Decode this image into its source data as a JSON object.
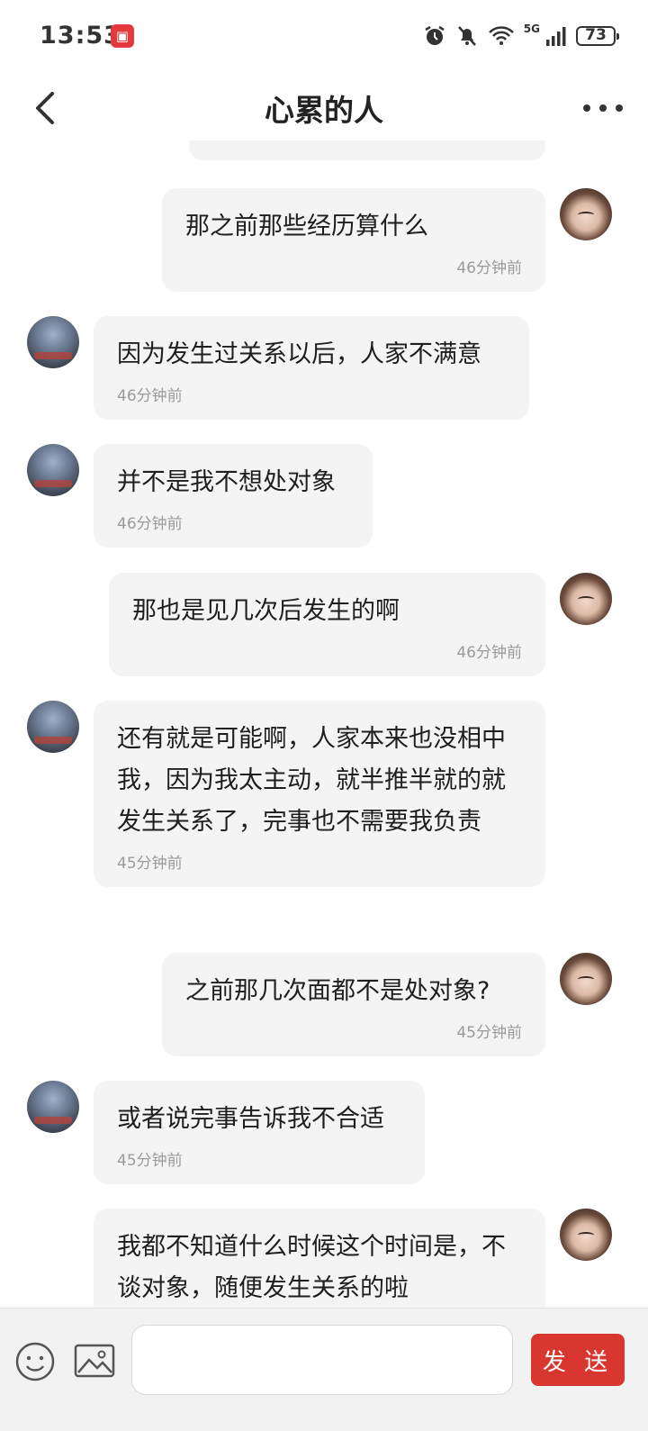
{
  "status_bar": {
    "time": "13:53",
    "app_icon": "calendar-icon",
    "network": "5G",
    "battery": "73"
  },
  "header": {
    "title": "心累的人",
    "back_icon": "back-arrow-icon",
    "more_icon": "more-dots-icon"
  },
  "messages": [
    {
      "sender": "self",
      "text": "那之前那些经历算什么",
      "time": "46分钟前"
    },
    {
      "sender": "other",
      "text": "因为发生过关系以后，人家不满意",
      "time": "46分钟前"
    },
    {
      "sender": "other",
      "text": "并不是我不想处对象",
      "time": "46分钟前"
    },
    {
      "sender": "self",
      "text": "那也是见几次后发生的啊",
      "time": "46分钟前"
    },
    {
      "sender": "other",
      "text": "还有就是可能啊，人家本来也没相中我，因为我太主动，就半推半就的就发生关系了，完事也不需要我负责",
      "time": "45分钟前"
    },
    {
      "sender": "self",
      "text": "之前那几次面都不是处对象?",
      "time": "45分钟前"
    },
    {
      "sender": "other",
      "text": "或者说完事告诉我不合适",
      "time": "45分钟前"
    },
    {
      "sender": "self",
      "text": "我都不知道什么时候这个时间是，不谈对象，随便发生关系的啦",
      "time": ""
    }
  ],
  "input_bar": {
    "placeholder": "",
    "send_label": "发 送",
    "emoji_icon": "emoji-icon",
    "image_icon": "image-icon"
  }
}
